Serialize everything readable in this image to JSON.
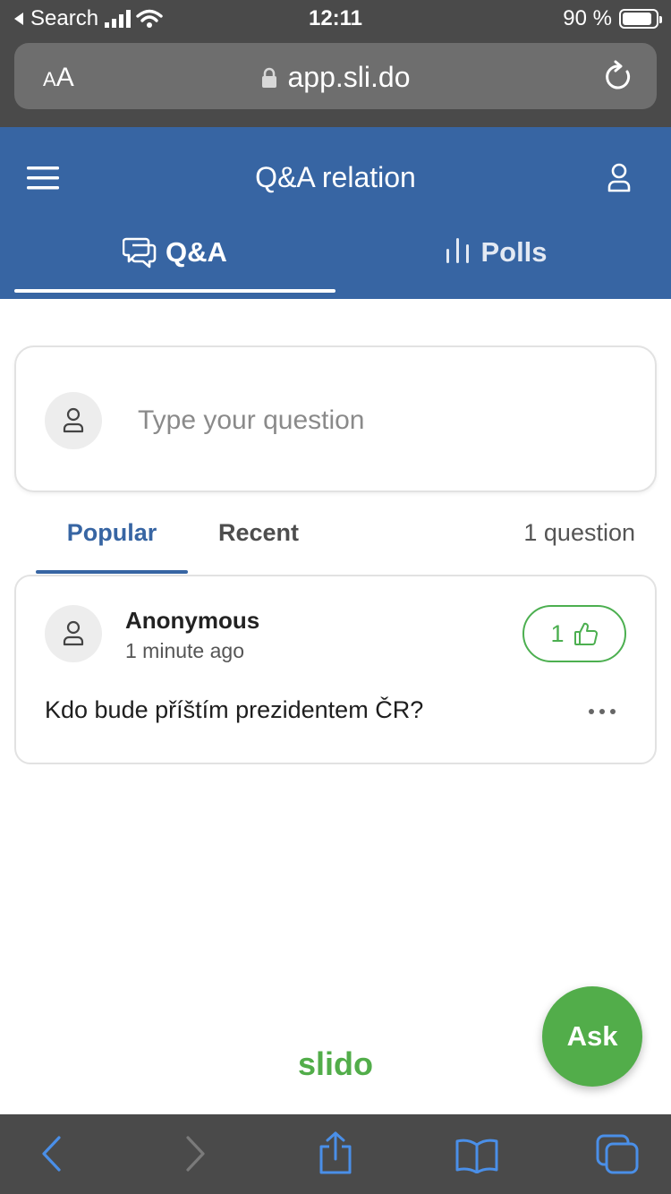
{
  "status_bar": {
    "back_app": "Search",
    "time": "12:11",
    "battery_percent": "90 %",
    "battery_level": 0.9
  },
  "browser": {
    "text_size_label_small": "A",
    "text_size_label_large": "A",
    "url": "app.sli.do"
  },
  "header": {
    "title": "Q&A relation",
    "tabs": [
      {
        "label": "Q&A",
        "icon": "chat-bubbles-icon",
        "active": true
      },
      {
        "label": "Polls",
        "icon": "bar-chart-icon",
        "active": false
      }
    ]
  },
  "ask_card": {
    "placeholder": "Type your question"
  },
  "sort": {
    "tabs": [
      {
        "label": "Popular",
        "active": true
      },
      {
        "label": "Recent",
        "active": false
      }
    ],
    "count": "1 question"
  },
  "questions": [
    {
      "author": "Anonymous",
      "time": "1 minute ago",
      "likes": "1",
      "text": "Kdo bude příštím prezidentem ČR?"
    }
  ],
  "footer": {
    "logo": "slido",
    "ask_button": "Ask"
  },
  "colors": {
    "brand_blue": "#3765a3",
    "brand_green": "#52ad4a",
    "browser_chrome": "#4a4a4a",
    "toolbar_icon": "#4a8fe8"
  }
}
